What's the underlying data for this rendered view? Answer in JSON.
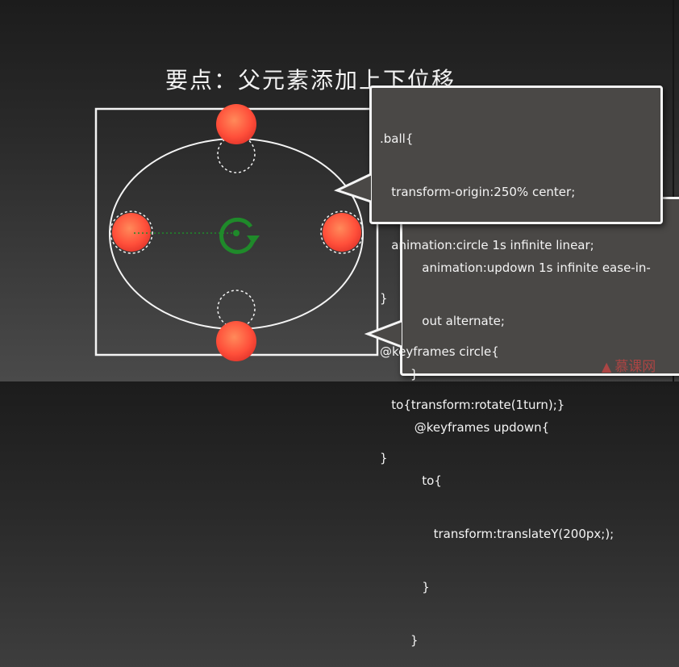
{
  "slide": {
    "title": "要点：父元素添加上下位移"
  },
  "code_box_1": {
    "lines": [
      ".ball{",
      "   transform-origin:250% center;",
      "   animation:circle 1s infinite linear;",
      "}",
      "@keyframes circle{",
      "   to{transform:rotate(1turn);}",
      "}"
    ]
  },
  "code_box_2": {
    "lines": [
      "   animation:updown 1s infinite ease-in-",
      "   out alternate;",
      "}",
      " @keyframes updown{",
      "   to{",
      "      transform:translateY(200px;);",
      "   }",
      "}"
    ]
  },
  "logo": {
    "text": "慕课网",
    "icon": "flame-icon"
  },
  "colors": {
    "ball": "#ff5a3c",
    "rotate_icon": "#1f8a2a",
    "chalk": "#f4f4f4"
  }
}
